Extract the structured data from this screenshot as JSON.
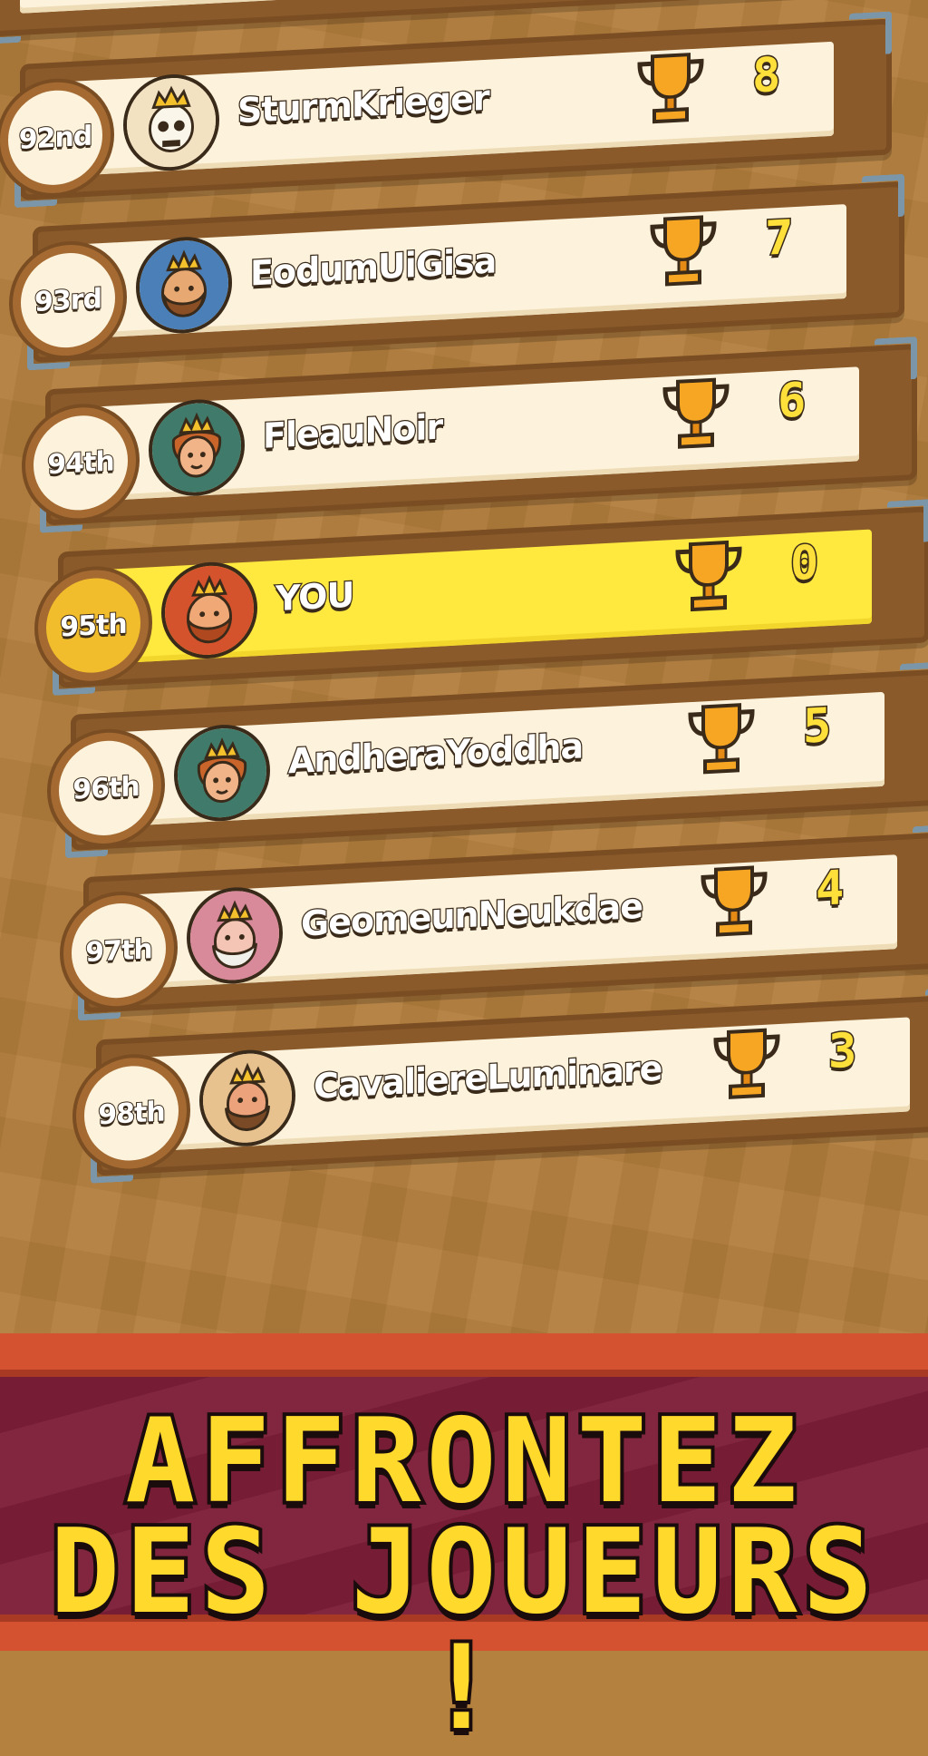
{
  "leaderboard": {
    "rows": [
      {
        "rank": "92nd",
        "name": "SturmKrieger",
        "score": "8",
        "avatar": "skeleton-king-icon",
        "highlight": false
      },
      {
        "rank": "93rd",
        "name": "EodumUiGisa",
        "score": "7",
        "avatar": "bearded-king-icon",
        "highlight": false
      },
      {
        "rank": "94th",
        "name": "FleauNoir",
        "score": "6",
        "avatar": "elf-queen-icon",
        "highlight": false
      },
      {
        "rank": "95th",
        "name": "YOU",
        "score": "0",
        "avatar": "redbeard-king-icon",
        "highlight": true
      },
      {
        "rank": "96th",
        "name": "AndheraYoddha",
        "score": "5",
        "avatar": "elf-queen-icon",
        "highlight": false
      },
      {
        "rank": "97th",
        "name": "GeomeunNeukdae",
        "score": "4",
        "avatar": "old-king-icon",
        "highlight": false
      },
      {
        "rank": "98th",
        "name": "CavaliereLuminare",
        "score": "3",
        "avatar": "dwarf-king-icon",
        "highlight": false
      }
    ],
    "trophy_icon": "trophy-icon"
  },
  "banner": {
    "line1": "AFFRONTEZ",
    "line2": "DES JOUEURS !"
  },
  "colors": {
    "highlight_row": "#ffe93f",
    "score_yellow": "#ffe03a",
    "banner_red": "#7d1f38",
    "banner_orange": "#d45230",
    "board_wood": "#b27d3c"
  }
}
